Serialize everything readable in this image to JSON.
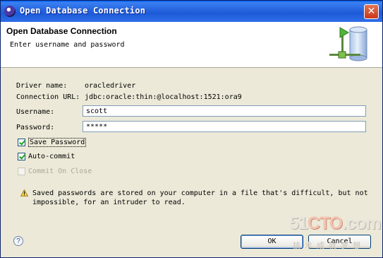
{
  "window": {
    "title": "Open Database Connection",
    "close_glyph": "✕"
  },
  "banner": {
    "title": "Open Database Connection",
    "subtitle": "Enter username and password",
    "image": "database-connection-icon"
  },
  "form": {
    "driver_label": "Driver name:",
    "driver_value": "oracledriver",
    "url_label": "Connection URL:",
    "url_value": "jdbc:oracle:thin:@localhost:1521:ora9",
    "username_label": "Username:",
    "username_value": "scott",
    "password_label": "Password:",
    "password_value": "*****"
  },
  "options": {
    "save_password": {
      "label": "Save Password",
      "checked": true
    },
    "auto_commit": {
      "label": "Auto-commit",
      "checked": true
    },
    "commit_on_close": {
      "label": "Commit On Close",
      "checked": false,
      "enabled": false
    }
  },
  "warning": {
    "icon": "warning-icon",
    "text": "Saved passwords are stored on your computer in a file that's difficult, but not impossible, for an intruder to read."
  },
  "buttons": {
    "ok": "OK",
    "cancel": "Cancel",
    "help": "?"
  },
  "watermark": {
    "brand_prefix": "51",
    "brand_accent": "CTO",
    "brand_suffix": ".com",
    "slogan": "技术成就梦想"
  },
  "colors": {
    "titlebar": "#2663de",
    "dialog": "#ece9d8",
    "check": "#21a121"
  }
}
